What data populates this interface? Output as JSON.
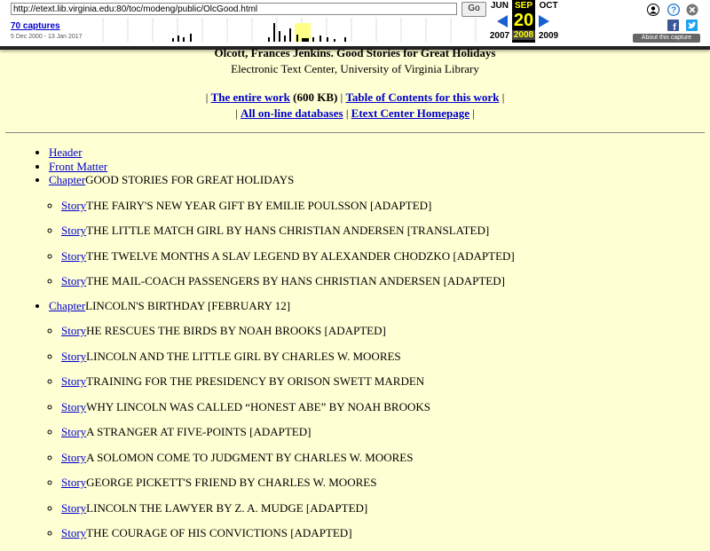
{
  "wayback": {
    "url": "http://etext.lib.virginia.edu:80/toc/modeng/public/OlcGood.html",
    "go_label": "Go",
    "captures": "70 captures",
    "date_range": "5 Dec 2000 - 13 Jan 2017",
    "prev_month": "JUN",
    "cur_month": "SEP",
    "next_month": "OCT",
    "cur_day": "20",
    "prev_year": "2007",
    "cur_year": "2008",
    "next_year": "2009",
    "about": "About this capture",
    "spark_heights": [
      0,
      0,
      0,
      0,
      0,
      0,
      0,
      0,
      0,
      0,
      0,
      0,
      0,
      0,
      0,
      0,
      0,
      0,
      0,
      0,
      0,
      0,
      0,
      0,
      0,
      0,
      0,
      0,
      0,
      0,
      0,
      0,
      0,
      0,
      0,
      0,
      0,
      0,
      0,
      0,
      0,
      0,
      0,
      0,
      0,
      0,
      0,
      0,
      0,
      0,
      0,
      0,
      0,
      0,
      0,
      0,
      0,
      0,
      0,
      0,
      0,
      0,
      0,
      0,
      0,
      0,
      0,
      0,
      0,
      0,
      0,
      0,
      0,
      0,
      0,
      0,
      0,
      0,
      0,
      0,
      0,
      0,
      0,
      0,
      0,
      0,
      0,
      0,
      0,
      0,
      0,
      0,
      0,
      0,
      0,
      0,
      0,
      0,
      0,
      0,
      0,
      0,
      0,
      0,
      0,
      0,
      0,
      0,
      0,
      0,
      0,
      0,
      0,
      0,
      0,
      0,
      0,
      0,
      0,
      0,
      0,
      0,
      0,
      0,
      0,
      0,
      0,
      0,
      0,
      0,
      0,
      0,
      0,
      0,
      0,
      0,
      0,
      0,
      0,
      0,
      0,
      0,
      0,
      0,
      0,
      0,
      0,
      0,
      0,
      0,
      0,
      0,
      0,
      0,
      0,
      0,
      0,
      0,
      0,
      0,
      0,
      0,
      0,
      0,
      0,
      0,
      0,
      0,
      0,
      0,
      0,
      0,
      0,
      0,
      0,
      0,
      0,
      0,
      0,
      0,
      0,
      0,
      0,
      0,
      0,
      0,
      0,
      0,
      0,
      0,
      0,
      0,
      0,
      0,
      0,
      0,
      0,
      0,
      0,
      0,
      0,
      0,
      0,
      0,
      0,
      0,
      0,
      0,
      0,
      0,
      0,
      0,
      0,
      0,
      0,
      0,
      0,
      0,
      0,
      0,
      0,
      0,
      0,
      0,
      0,
      0,
      0,
      0,
      0,
      0,
      0,
      0,
      0,
      0,
      0,
      0,
      0,
      0,
      0,
      0,
      0,
      0,
      0,
      0,
      0,
      0,
      0,
      0,
      0,
      0,
      0,
      0,
      0,
      0,
      0,
      0,
      0,
      0,
      0,
      0,
      0,
      0,
      0,
      0,
      0,
      0,
      0,
      0,
      0,
      0,
      0,
      0,
      0,
      0,
      0,
      0,
      0,
      0,
      0,
      0,
      0,
      0,
      0,
      0,
      0,
      0,
      0,
      0,
      0,
      0,
      0,
      0,
      0,
      0,
      0,
      0,
      0,
      0,
      0,
      0,
      0,
      0,
      0,
      0,
      0,
      0,
      0,
      0,
      0,
      0,
      0,
      0,
      0,
      0,
      0,
      0,
      0,
      0,
      0,
      0,
      0,
      0,
      0,
      0,
      0,
      0,
      0,
      0,
      0,
      0,
      0,
      0,
      0,
      0,
      0,
      0,
      0,
      0,
      0,
      0,
      0,
      0,
      0,
      0,
      0,
      0,
      0,
      0,
      0,
      0,
      0,
      0,
      0,
      0,
      0,
      0,
      0,
      0,
      0,
      0,
      0,
      0,
      0,
      0,
      0,
      0,
      0,
      0,
      0,
      0,
      0,
      0,
      0,
      0,
      0,
      0,
      0,
      0,
      0,
      0,
      0,
      0,
      0,
      0,
      0,
      0,
      0,
      0,
      0,
      0,
      0,
      0,
      0,
      0,
      0,
      0,
      0,
      0,
      0,
      0,
      0,
      0,
      0,
      0,
      0,
      0,
      0,
      0,
      0,
      0,
      0,
      0,
      0,
      0,
      0,
      0,
      0,
      0,
      0,
      0,
      0,
      0,
      0,
      0,
      0,
      0,
      0,
      0,
      0,
      0,
      0,
      0,
      0,
      0,
      0,
      0,
      0,
      0,
      0,
      0
    ]
  },
  "page": {
    "title": "Olcott, Frances Jenkins. Good Stories for Great Holidays",
    "subtitle": "Electronic Text Center, University of Virginia Library",
    "nav": {
      "entire_work": "The entire work",
      "size": "(600 KB)",
      "toc": "Table of Contents for this work",
      "databases": "All on-line databases",
      "homepage": "Etext Center Homepage",
      "sep": "|"
    },
    "header_link": "Header",
    "front_matter_link": "Front Matter",
    "chapter_label": "Chapter",
    "story_label": "Story",
    "chapter1_title": "GOOD STORIES FOR GREAT HOLIDAYS",
    "chapter1_stories": [
      "THE FAIRY'S NEW YEAR GIFT BY EMILIE POULSSON [ADAPTED]",
      "THE LITTLE MATCH GIRL BY HANS CHRISTIAN ANDERSEN [TRANSLATED]",
      "THE TWELVE MONTHS A SLAV LEGEND BY ALEXANDER CHODZKO [ADAPTED]",
      "THE MAIL-COACH PASSENGERS BY HANS CHRISTIAN ANDERSEN [ADAPTED]"
    ],
    "chapter2_title": "LINCOLN'S BIRTHDAY [FEBRUARY 12]",
    "chapter2_stories": [
      "HE RESCUES THE BIRDS BY NOAH BROOKS [ADAPTED]",
      "LINCOLN AND THE LITTLE GIRL BY CHARLES W. MOORES",
      "TRAINING FOR THE PRESIDENCY BY ORISON SWETT MARDEN",
      "WHY LINCOLN WAS CALLED “HONEST ABE” BY NOAH BROOKS",
      "A STRANGER AT FIVE-POINTS [ADAPTED]",
      "A SOLOMON COME TO JUDGMENT BY CHARLES W. MOORES",
      "GEORGE PICKETT'S FRIEND BY CHARLES W. MOORES",
      "LINCOLN THE LAWYER BY Z. A. MUDGE [ADAPTED]",
      "THE COURAGE OF HIS CONVICTIONS [ADAPTED]"
    ]
  }
}
